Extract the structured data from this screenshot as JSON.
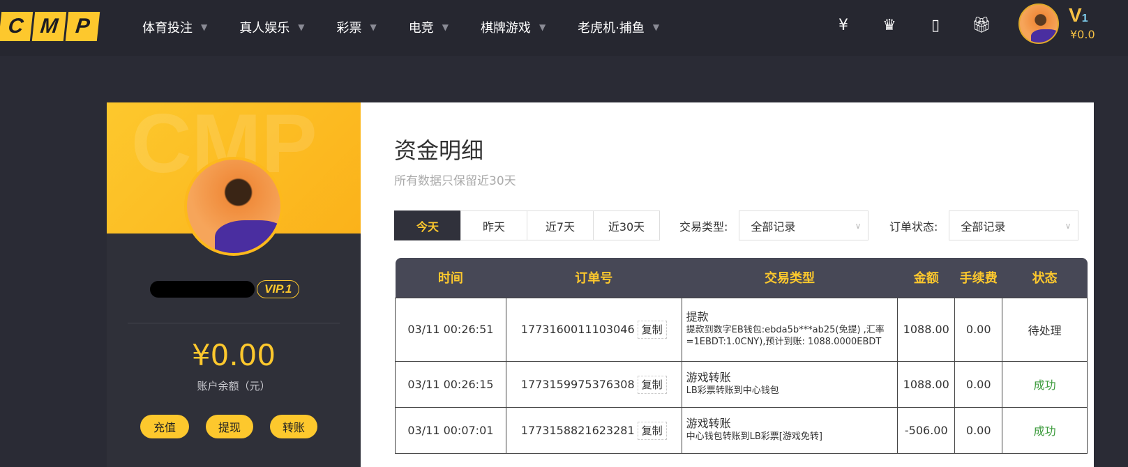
{
  "nav": {
    "logo": [
      "C",
      "M",
      "P"
    ],
    "menu": [
      "体育投注",
      "真人娱乐",
      "彩票",
      "电竞",
      "棋牌游戏",
      "老虎机·捕鱼"
    ],
    "icons": [
      "yen-ticket-icon",
      "crown-icon",
      "tablet-icon",
      "gift-icon"
    ],
    "vip": "V",
    "vip_level": "1",
    "balance": "¥0.0"
  },
  "profile": {
    "watermark": "CMP",
    "vip": "VIP.1",
    "balance": "¥0.00",
    "balance_label": "账户余额（元）",
    "buttons": [
      "充值",
      "提现",
      "转账"
    ]
  },
  "main": {
    "title": "资金明细",
    "subtitle": "所有数据只保留近30天",
    "tabs": [
      "今天",
      "昨天",
      "近7天",
      "近30天"
    ],
    "active_tab": "今天",
    "filters": [
      {
        "label": "交易类型:",
        "value": "全部记录"
      },
      {
        "label": "订单状态:",
        "value": "全部记录"
      }
    ],
    "columns": [
      "时间",
      "订单号",
      "交易类型",
      "金额",
      "手续费",
      "状态"
    ],
    "copy_label": "复制",
    "rows": [
      {
        "time": "03/11 00:26:51",
        "order": "1773160011103046",
        "type": "提款",
        "detail": "提款到数字EB钱包:ebda5b***ab25(免提) ,汇率=1EBDT:1.0CNY),预计到账: 1088.0000EBDT",
        "amount": "1088.00",
        "fee": "0.00",
        "status": "待处理"
      },
      {
        "time": "03/11 00:26:15",
        "order": "1773159975376308",
        "type": "游戏转账",
        "detail": "LB彩票转账到中心钱包",
        "amount": "1088.00",
        "fee": "0.00",
        "status": "成功"
      },
      {
        "time": "03/11 00:07:01",
        "order": "1773158821623281",
        "type": "游戏转账",
        "detail": "中心钱包转账到LB彩票[游戏免转]",
        "amount": "-506.00",
        "fee": "0.00",
        "status": "成功"
      }
    ]
  },
  "colors": {
    "accent": "#fdc82d",
    "success": "#3c9b3c",
    "nav_bg": "#262730"
  }
}
